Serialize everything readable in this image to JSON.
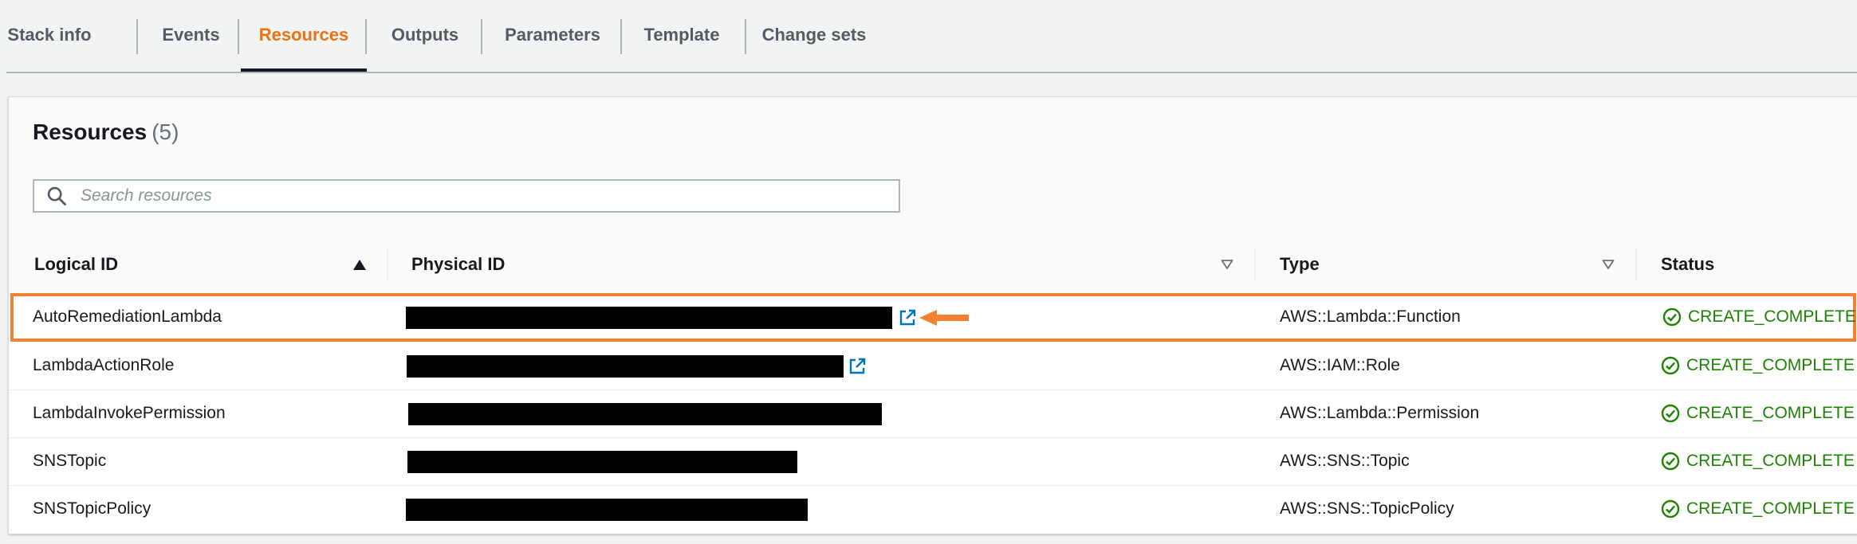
{
  "tabs": [
    {
      "label": "Stack info",
      "active": false
    },
    {
      "label": "Events",
      "active": false
    },
    {
      "label": "Resources",
      "active": true
    },
    {
      "label": "Outputs",
      "active": false
    },
    {
      "label": "Parameters",
      "active": false
    },
    {
      "label": "Template",
      "active": false
    },
    {
      "label": "Change sets",
      "active": false
    }
  ],
  "panel": {
    "title": "Resources",
    "count": "(5)"
  },
  "search": {
    "placeholder": "Search resources",
    "value": ""
  },
  "columns": {
    "logical_id": "Logical ID",
    "physical_id": "Physical ID",
    "type": "Type",
    "status": "Status"
  },
  "rows": [
    {
      "logical_id": "AutoRemediationLambda",
      "type": "AWS::Lambda::Function",
      "status": "CREATE_COMPLETE"
    },
    {
      "logical_id": "LambdaActionRole",
      "type": "AWS::IAM::Role",
      "status": "CREATE_COMPLETE"
    },
    {
      "logical_id": "LambdaInvokePermission",
      "type": "AWS::Lambda::Permission",
      "status": "CREATE_COMPLETE"
    },
    {
      "logical_id": "SNSTopic",
      "type": "AWS::SNS::Topic",
      "status": "CREATE_COMPLETE"
    },
    {
      "logical_id": "SNSTopicPolicy",
      "type": "AWS::SNS::TopicPolicy",
      "status": "CREATE_COMPLETE"
    }
  ],
  "colors": {
    "accent": "#ec7211",
    "success": "#1d8102",
    "link": "#0073bb",
    "highlight": "#f48132"
  }
}
